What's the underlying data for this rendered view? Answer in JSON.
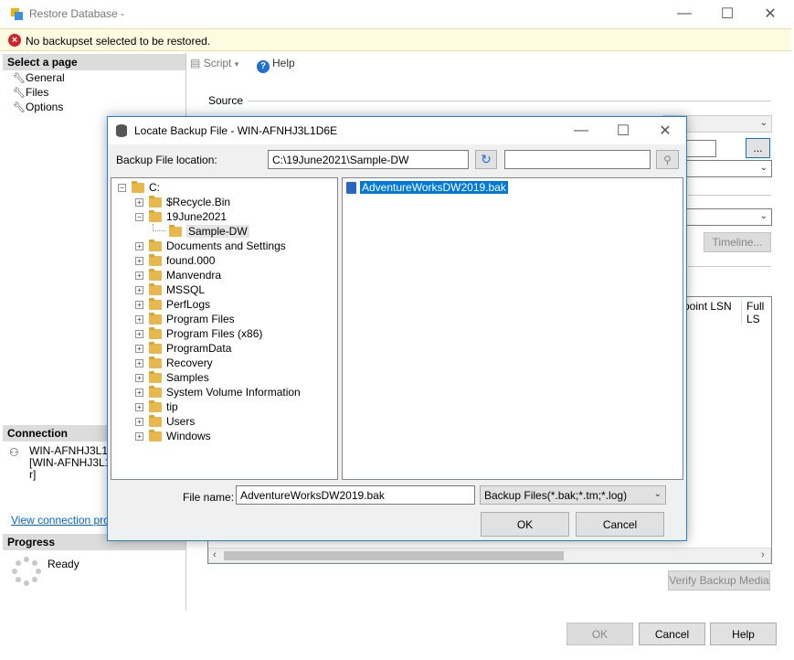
{
  "window": {
    "title": "Restore Database -",
    "error_message": "No backupset selected to be restored."
  },
  "left": {
    "select_page_header": "Select a page",
    "pages": [
      "General",
      "Files",
      "Options"
    ],
    "connection_header": "Connection",
    "connection_lines": [
      "WIN-AFNHJ3L1D",
      "[WIN-AFNHJ3L1D",
      "r]"
    ],
    "view_connection_link": "View connection prope",
    "progress_header": "Progress",
    "progress_status": "Ready"
  },
  "toolbar": {
    "script_label": "Script",
    "help_label": "Help"
  },
  "main": {
    "source_label": "Source",
    "browse_label": "...",
    "timeline_label": "Timeline...",
    "col_checkpoint_lsn": "point LSN",
    "col_full_lsn": "Full LS",
    "verify_label": "Verify Backup Media"
  },
  "footer": {
    "ok_label": "OK",
    "cancel_label": "Cancel",
    "help_label": "Help"
  },
  "dialog": {
    "title": "Locate Backup File - WIN-AFNHJ3L1D6E",
    "location_label": "Backup File location:",
    "location_value": "C:\\19June2021\\Sample-DW",
    "search_value": "",
    "tree": {
      "root": "C:",
      "items": [
        {
          "label": "$Recycle.Bin",
          "expander": "+"
        },
        {
          "label": "19June2021",
          "expander": "−"
        },
        {
          "label": "Sample-DW",
          "expander": ""
        },
        {
          "label": "Documents and Settings",
          "expander": "+"
        },
        {
          "label": "found.000",
          "expander": "+"
        },
        {
          "label": "Manvendra",
          "expander": "+"
        },
        {
          "label": "MSSQL",
          "expander": "+"
        },
        {
          "label": "PerfLogs",
          "expander": "+"
        },
        {
          "label": "Program Files",
          "expander": "+"
        },
        {
          "label": "Program Files (x86)",
          "expander": "+"
        },
        {
          "label": "ProgramData",
          "expander": "+"
        },
        {
          "label": "Recovery",
          "expander": "+"
        },
        {
          "label": "Samples",
          "expander": "+"
        },
        {
          "label": "System Volume Information",
          "expander": "+"
        },
        {
          "label": "tip",
          "expander": "+"
        },
        {
          "label": "Users",
          "expander": "+"
        },
        {
          "label": "Windows",
          "expander": "+"
        }
      ]
    },
    "files": [
      "AdventureWorksDW2019.bak"
    ],
    "filename_label": "File name:",
    "filename_value": "AdventureWorksDW2019.bak",
    "filetype_value": "Backup Files(*.bak;*.tm;*.log)",
    "ok_label": "OK",
    "cancel_label": "Cancel"
  },
  "colors": {
    "accent": "#0078d7",
    "error": "#d2232a",
    "error_bg": "#fffbe0"
  }
}
